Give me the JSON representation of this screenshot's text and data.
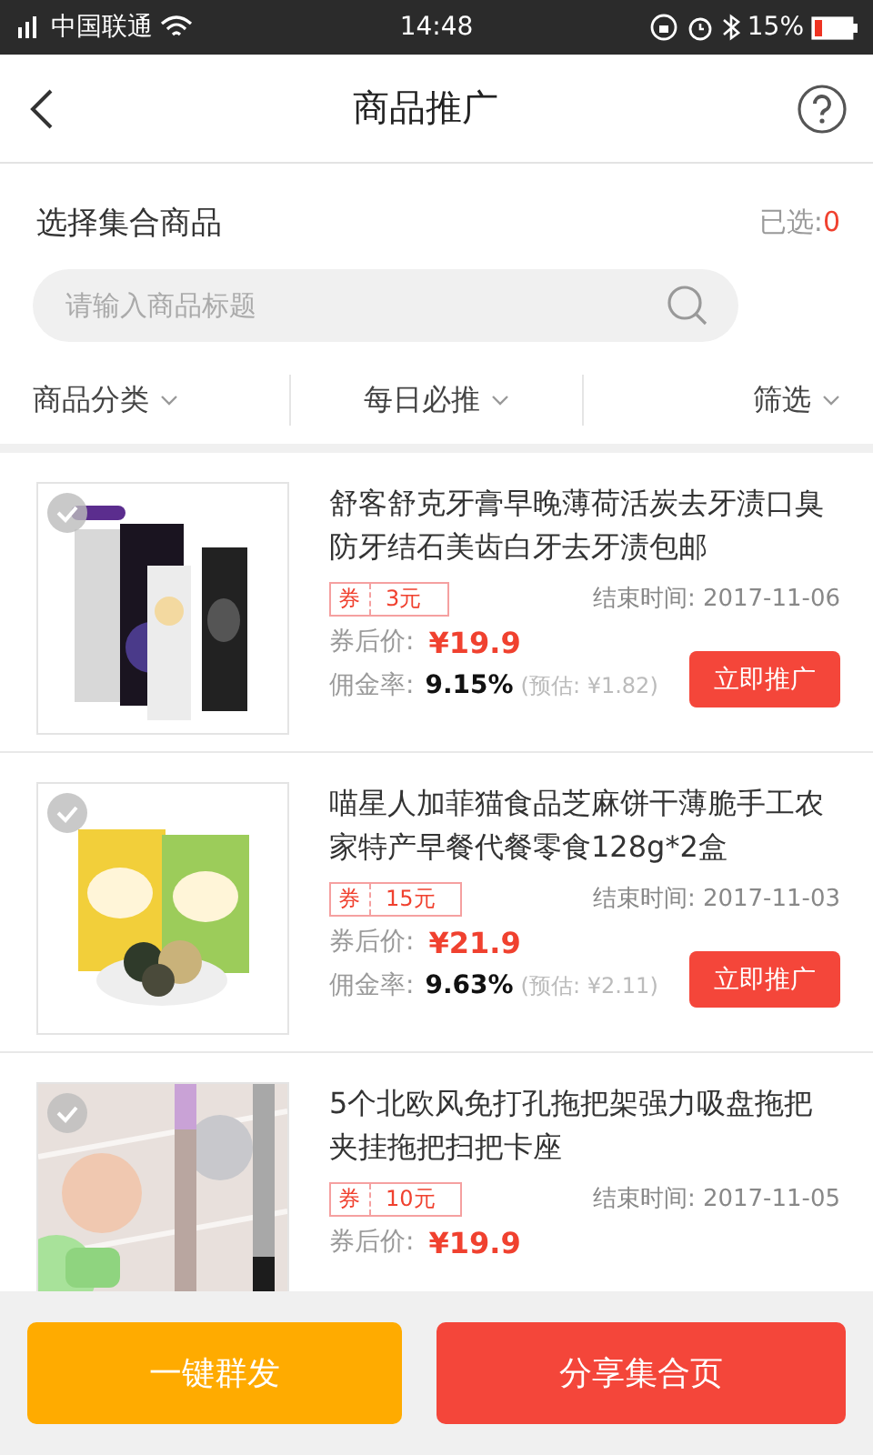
{
  "status_bar": {
    "carrier": "中国联通",
    "time": "14:48",
    "battery": "15%"
  },
  "header": {
    "title": "商品推广"
  },
  "selection": {
    "label": "选择集合商品",
    "count_label": "已选:",
    "count": "0"
  },
  "search": {
    "placeholder": "请输入商品标题"
  },
  "filters": [
    {
      "label": "商品分类"
    },
    {
      "label": "每日必推"
    },
    {
      "label": "筛选"
    }
  ],
  "products": [
    {
      "selected": false,
      "title": "舒客舒克牙膏早晚薄荷活炭去牙渍口臭防牙结石美齿白牙去牙渍包邮",
      "coupon_tag": "券",
      "coupon": "3元",
      "end_time": "结束时间: 2017-11-06",
      "price_label": "券后价:",
      "price": "¥19.9",
      "commission_label": "佣金率:",
      "commission": "9.15%",
      "estimate": "(预估: ¥1.82)",
      "promote": "立即推广"
    },
    {
      "selected": false,
      "title": "喵星人加菲猫食品芝麻饼干薄脆手工农家特产早餐代餐零食128g*2盒",
      "coupon_tag": "券",
      "coupon": "15元",
      "end_time": "结束时间: 2017-11-03",
      "price_label": "券后价:",
      "price": "¥21.9",
      "commission_label": "佣金率:",
      "commission": "9.63%",
      "estimate": "(预估: ¥2.11)",
      "promote": "立即推广"
    },
    {
      "selected": false,
      "title": "5个北欧风免打孔拖把架强力吸盘拖把夹挂拖把扫把卡座",
      "coupon_tag": "券",
      "coupon": "10元",
      "end_time": "结束时间: 2017-11-05",
      "price_label": "券后价:",
      "price": "¥19.9"
    }
  ],
  "footer": {
    "buttons": [
      {
        "label": "一键群发",
        "kind": "secondary"
      },
      {
        "label": "分享集合页",
        "kind": "primary"
      }
    ]
  }
}
